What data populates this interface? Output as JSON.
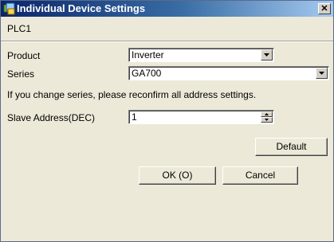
{
  "window": {
    "title": "Individual Device Settings",
    "close_label": "✕"
  },
  "header": {
    "device_name": "PLC1"
  },
  "form": {
    "product": {
      "label": "Product",
      "value": "Inverter"
    },
    "series": {
      "label": "Series",
      "value": "GA700"
    },
    "message": "If you change series, please reconfirm all address settings.",
    "slave_address": {
      "label": "Slave Address(DEC)",
      "value": "1"
    }
  },
  "buttons": {
    "default": "Default",
    "ok": "OK (O)",
    "cancel": "Cancel"
  }
}
